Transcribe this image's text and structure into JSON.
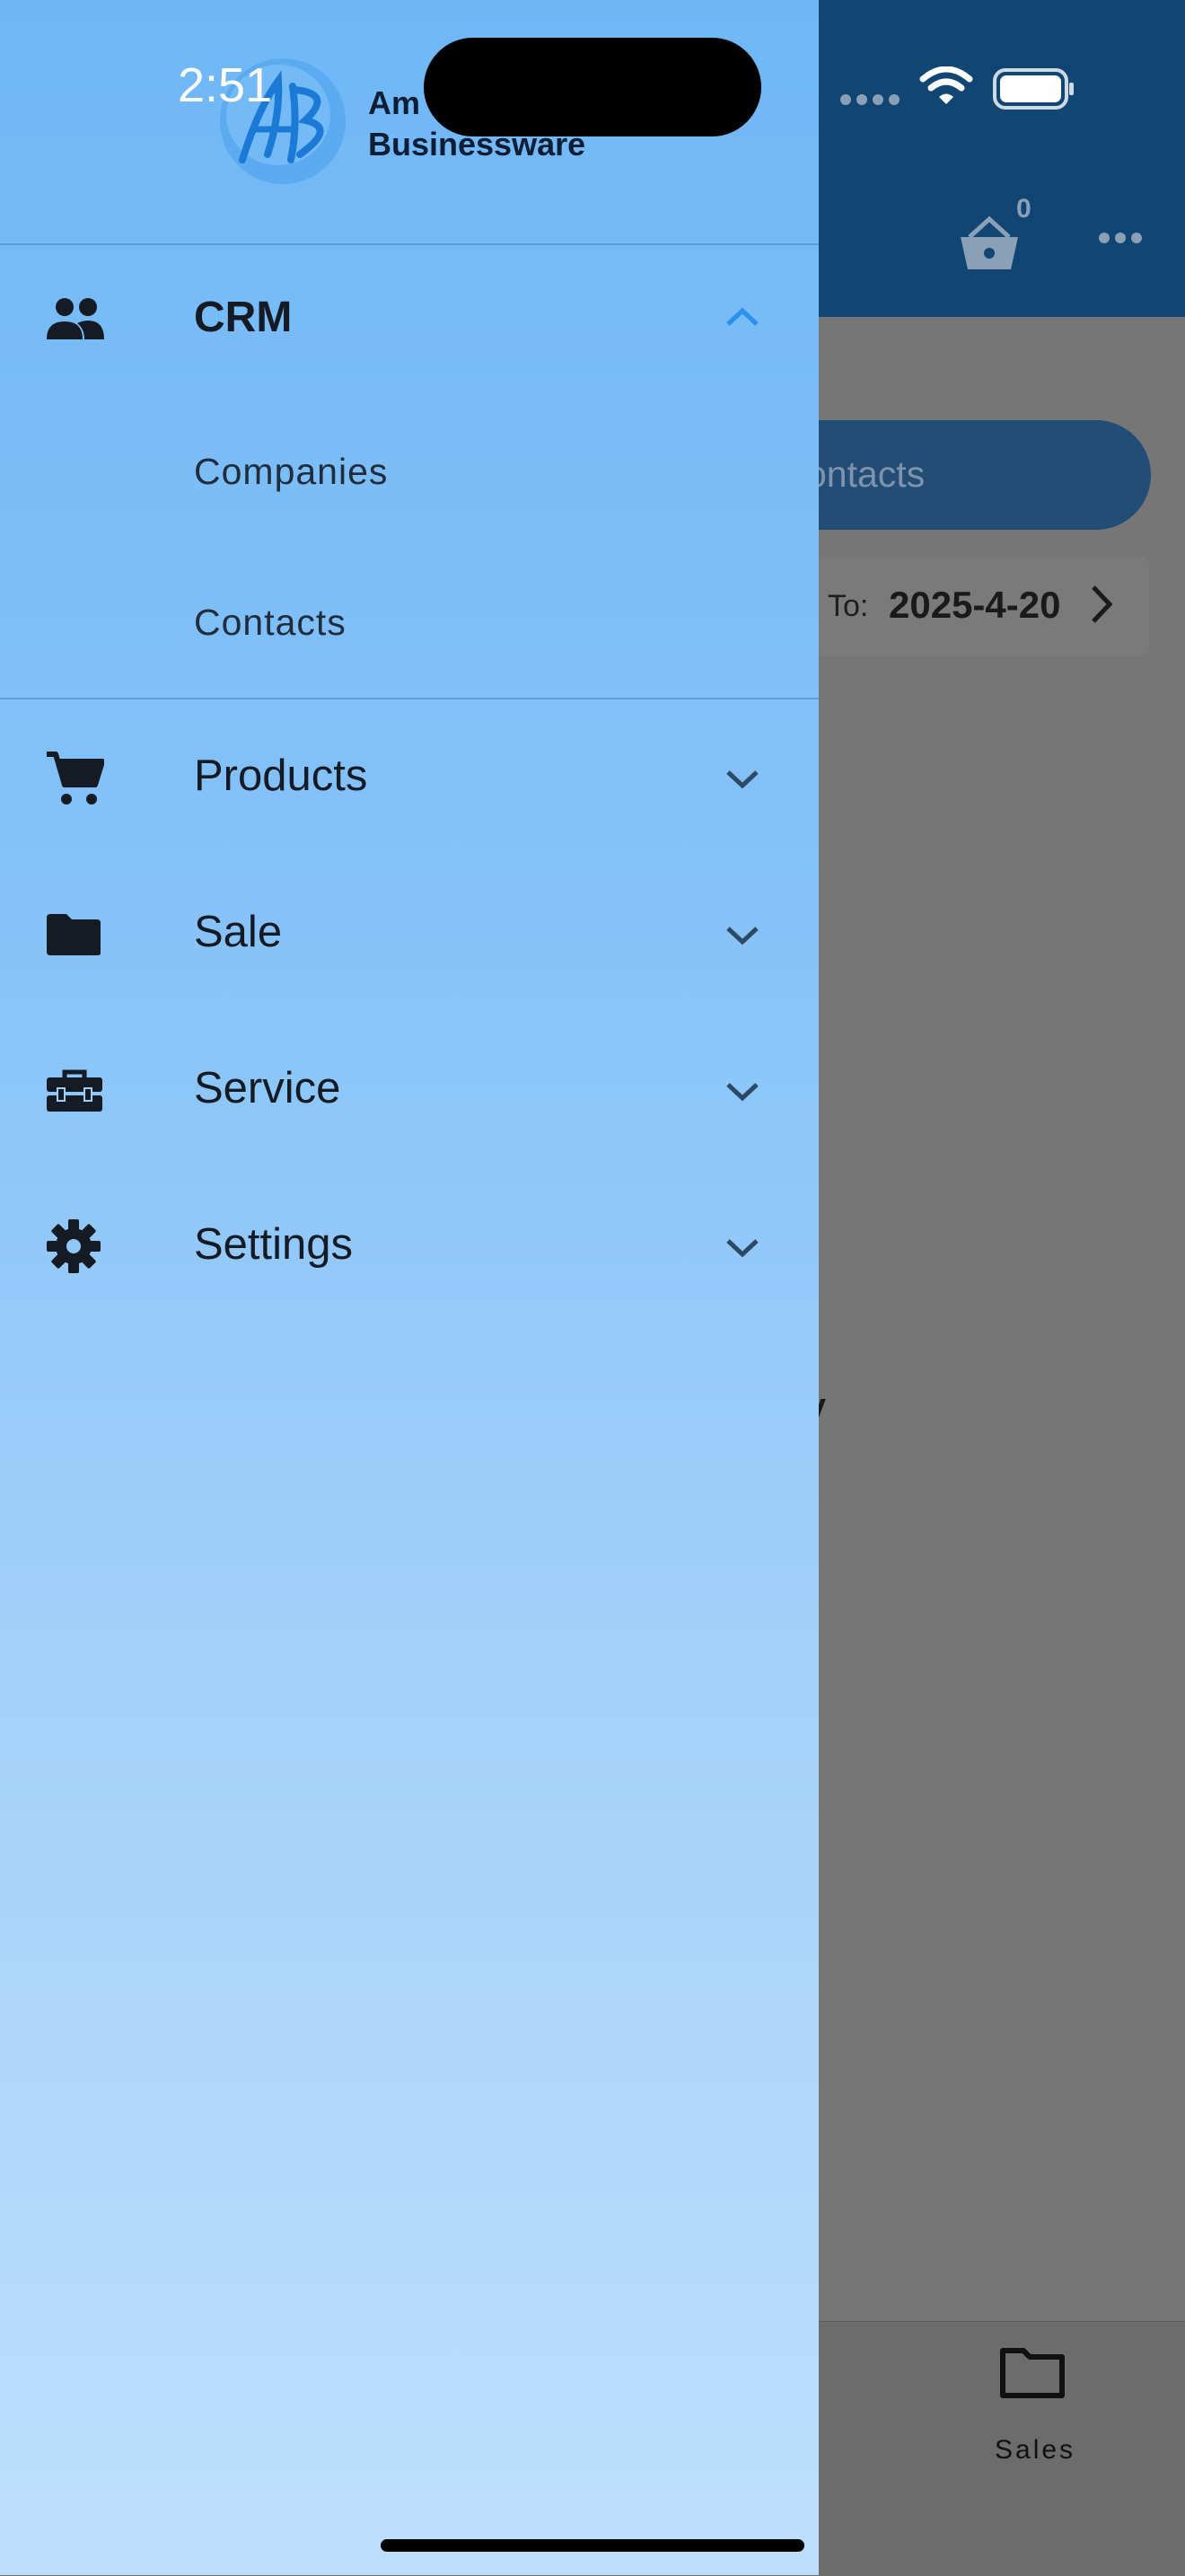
{
  "status_bar": {
    "time": "2:51"
  },
  "drawer": {
    "brand_line1": "Am",
    "brand_line2": "Businessware",
    "menu": [
      {
        "label": "CRM",
        "icon": "people-icon",
        "expanded": true,
        "children": [
          {
            "label": "Companies"
          },
          {
            "label": "Contacts"
          }
        ]
      },
      {
        "label": "Products",
        "icon": "cart-icon",
        "expanded": false
      },
      {
        "label": "Sale",
        "icon": "folder-icon",
        "expanded": false
      },
      {
        "label": "Service",
        "icon": "toolbox-icon",
        "expanded": false
      },
      {
        "label": "Settings",
        "icon": "gear-icon",
        "expanded": false
      }
    ]
  },
  "background": {
    "cart_count": "0",
    "tab_label": "ontacts",
    "to_label": "To:",
    "to_date": "2025-4-20",
    "partial_text": "y",
    "bottom_nav_label": "Sales"
  },
  "colors": {
    "drawer_top": "#6fb7f6",
    "drawer_bottom": "#bedffc",
    "header": "#114674",
    "crm_chevron": "#2b8ff0",
    "scrim": "#6f6f6f"
  }
}
